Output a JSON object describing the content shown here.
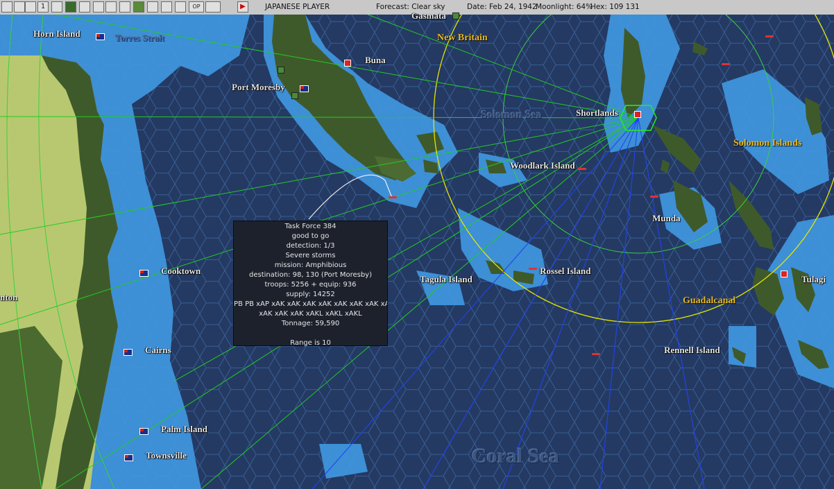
{
  "toolbar": {
    "buttons": [
      {
        "label": "",
        "icon": "map-view-icon"
      },
      {
        "label": "",
        "icon": "grid-icon"
      },
      {
        "label": "",
        "icon": "layers-icon"
      },
      {
        "label": "1",
        "icon": "one-icon"
      },
      {
        "label": "",
        "icon": "rising-sun-icon"
      },
      {
        "label": "",
        "icon": "ground-units-icon"
      },
      {
        "label": "",
        "icon": "air-units-icon"
      },
      {
        "label": "",
        "icon": "flag-icon"
      },
      {
        "label": "",
        "icon": "ship-icon"
      },
      {
        "label": "",
        "icon": "route-icon"
      },
      {
        "label": "",
        "icon": "terrain-icon"
      },
      {
        "label": "",
        "icon": "chart-icon"
      },
      {
        "label": "",
        "icon": "globe-icon"
      },
      {
        "label": "",
        "icon": "target-icon"
      },
      {
        "label": "OP",
        "icon": "op-icon"
      },
      {
        "label": "",
        "icon": "monitor-icon"
      },
      {
        "label": "▶",
        "icon": "play-icon"
      }
    ],
    "player": "JAPANESE PLAYER",
    "forecast": "Forecast: Clear sky",
    "date": "Date: Feb 24, 1942",
    "moonlight": "Moonlight: 64%",
    "hex": "Hex: 109 131"
  },
  "places": [
    {
      "name": "Horn Island"
    },
    {
      "name": "Port Moresby"
    },
    {
      "name": "Buna"
    },
    {
      "name": "Gasmata"
    },
    {
      "name": "Shortlands"
    },
    {
      "name": "Woodlark Island"
    },
    {
      "name": "Munda"
    },
    {
      "name": "Cooktown"
    },
    {
      "name": "Tagula Island"
    },
    {
      "name": "Rossel Island"
    },
    {
      "name": "Tulagi"
    },
    {
      "name": "Cairns"
    },
    {
      "name": "Rennell Island"
    },
    {
      "name": "Palm Island"
    },
    {
      "name": "Townsville"
    },
    {
      "name": "nton"
    }
  ],
  "regions": [
    {
      "name": "New Britain"
    },
    {
      "name": "Solomon Islands"
    },
    {
      "name": "Guadalcanal"
    }
  ],
  "seas": [
    {
      "name": "Torres Strait"
    },
    {
      "name": "Solomon Sea"
    },
    {
      "name": "Coral Sea"
    }
  ],
  "tooltip": {
    "lines": [
      "Task Force 384",
      "good to go",
      "detection: 1/3",
      "Severe storms",
      "mission: Amphibious",
      "destination: 98, 130 (Port Moresby)",
      "troops: 5256 + equip: 936",
      "supply: 14252",
      "PB PB xAP xAK xAK xAK xAK xAK xAK xAK xAK",
      "xAK xAK xAK xAKL xAKL xAKL",
      "Tonnage: 59,590",
      "",
      "Range is 10"
    ]
  },
  "colors": {
    "deep_ocean": "#243a63",
    "shallow_water": "#3d8fd6",
    "land_jungle": "#3f5a2a",
    "land_grass": "#b8c870",
    "range_ring": "#e6e600",
    "green_ring": "#3cd03c",
    "green_lines": "#22cc22",
    "blue_lines": "#2244ee",
    "region_label": "#e8b820"
  }
}
